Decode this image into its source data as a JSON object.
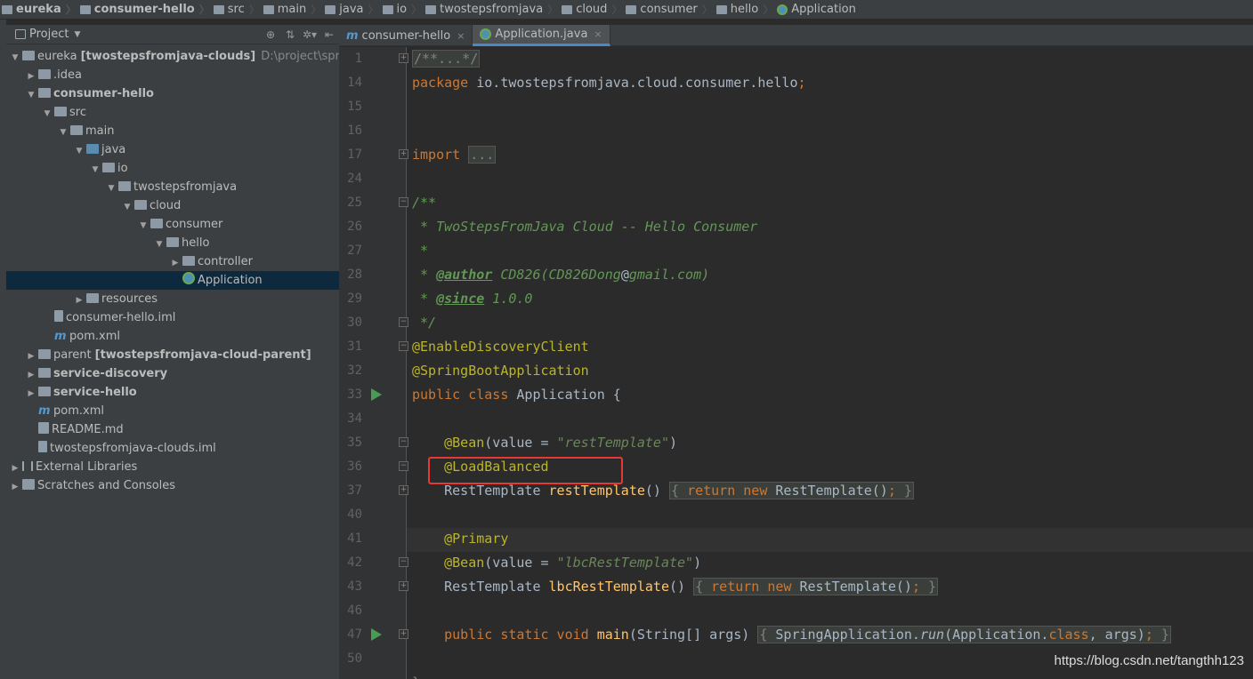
{
  "breadcrumb": [
    "eureka",
    "consumer-hello",
    "src",
    "main",
    "java",
    "io",
    "twostepsfromjava",
    "cloud",
    "consumer",
    "hello",
    "Application"
  ],
  "project_panel": {
    "title": "Project"
  },
  "tree": [
    {
      "depth": 0,
      "arrow": "down",
      "icon": "folder",
      "label": "eureka",
      "bold_extra": "[twostepsfromjava-clouds]",
      "extra": "D:\\project\\springClo"
    },
    {
      "depth": 1,
      "arrow": "right",
      "icon": "folder",
      "label": ".idea"
    },
    {
      "depth": 1,
      "arrow": "down",
      "icon": "folder",
      "label": "consumer-hello",
      "bold": true
    },
    {
      "depth": 2,
      "arrow": "down",
      "icon": "folder",
      "label": "src"
    },
    {
      "depth": 3,
      "arrow": "down",
      "icon": "folder",
      "label": "main"
    },
    {
      "depth": 4,
      "arrow": "down",
      "icon": "src",
      "label": "java"
    },
    {
      "depth": 5,
      "arrow": "down",
      "icon": "folder",
      "label": "io"
    },
    {
      "depth": 6,
      "arrow": "down",
      "icon": "folder",
      "label": "twostepsfromjava"
    },
    {
      "depth": 7,
      "arrow": "down",
      "icon": "folder",
      "label": "cloud"
    },
    {
      "depth": 8,
      "arrow": "down",
      "icon": "folder",
      "label": "consumer"
    },
    {
      "depth": 9,
      "arrow": "down",
      "icon": "folder",
      "label": "hello"
    },
    {
      "depth": 10,
      "arrow": "right",
      "icon": "folder",
      "label": "controller"
    },
    {
      "depth": 10,
      "arrow": "",
      "icon": "app",
      "label": "Application",
      "selected": true
    },
    {
      "depth": 4,
      "arrow": "right",
      "icon": "folder",
      "label": "resources"
    },
    {
      "depth": 2,
      "arrow": "",
      "icon": "iml",
      "label": "consumer-hello.iml"
    },
    {
      "depth": 2,
      "arrow": "",
      "icon": "maven",
      "label": "pom.xml"
    },
    {
      "depth": 1,
      "arrow": "right",
      "icon": "folder",
      "label": "parent",
      "bold_extra": "[twostepsfromjava-cloud-parent]"
    },
    {
      "depth": 1,
      "arrow": "right",
      "icon": "folder",
      "label": "service-discovery",
      "bold": true
    },
    {
      "depth": 1,
      "arrow": "right",
      "icon": "folder",
      "label": "service-hello",
      "bold": true
    },
    {
      "depth": 1,
      "arrow": "",
      "icon": "maven",
      "label": "pom.xml"
    },
    {
      "depth": 1,
      "arrow": "",
      "icon": "md",
      "label": "README.md"
    },
    {
      "depth": 1,
      "arrow": "",
      "icon": "iml",
      "label": "twostepsfromjava-clouds.iml"
    },
    {
      "depth": 0,
      "arrow": "right",
      "icon": "lib",
      "label": "External Libraries"
    },
    {
      "depth": 0,
      "arrow": "right",
      "icon": "scratch",
      "label": "Scratches and Consoles"
    }
  ],
  "tabs": [
    {
      "label": "consumer-hello",
      "icon": "maven",
      "active": false
    },
    {
      "label": "Application.java",
      "icon": "app",
      "active": true
    }
  ],
  "gutter": {
    "line_numbers": [
      "1",
      "14",
      "15",
      "16",
      "17",
      "24",
      "25",
      "26",
      "27",
      "28",
      "29",
      "30",
      "31",
      "32",
      "33",
      "34",
      "35",
      "36",
      "37",
      "40",
      "41",
      "42",
      "43",
      "46",
      "47",
      "50"
    ]
  },
  "code": {
    "l1_fold": "/**...*/",
    "l14_kw": "package",
    "l14_rest": " io.twostepsfromjava.cloud.consumer.hello",
    "l14_semi": ";",
    "l17_kw": "import",
    "l17_fold": "...",
    "l25": "/**",
    "l26": " * TwoStepsFromJava Cloud -- Hello Consumer",
    "l27": " *",
    "l28_star": " * ",
    "l28_tag": "@author",
    "l28_a": " CD826(CD826Dong",
    "l28_at": "@",
    "l28_b": "gmail.com)",
    "l29_star": " * ",
    "l29_tag": "@since",
    "l29_val": " 1.0.0",
    "l30": " */",
    "l31": "@EnableDiscoveryClient",
    "l32": "@SpringBootApplication",
    "l33_kw": "public class",
    "l33_rest": " Application {",
    "l35_an": "    @Bean",
    "l35_a": "(value = ",
    "l35_str": "\"restTemplate\"",
    "l35_b": ")",
    "l36": "    @LoadBalanced",
    "l37_a": "    RestTemplate ",
    "l37_fn": "restTemplate",
    "l37_b": "() ",
    "l37_fold_kw1": "return new",
    "l37_fold_rest": " RestTemplate()",
    "l41": "    @Primary",
    "l42_an": "    @Bean",
    "l42_a": "(value = ",
    "l42_str": "\"lbcRestTemplate\"",
    "l42_b": ")",
    "l43_a": "    RestTemplate ",
    "l43_fn": "lbcRestTemplate",
    "l43_b": "() ",
    "l43_fold_kw1": "return new",
    "l43_fold_rest": " RestTemplate()",
    "l47_kw": "    public static void",
    "l47_fn": " main",
    "l47_a": "(String[] args) ",
    "l47_f1": "SpringApplication.",
    "l47_run": "run",
    "l47_f2": "(Application.",
    "l47_cls": "class",
    "l47_f3": ", args)"
  },
  "watermark": "https://blog.csdn.net/tangthh123",
  "colors": {
    "keyword": "#cc7832",
    "annotation": "#bbb529",
    "string": "#6a8759",
    "doc_comment": "#629755",
    "method": "#ffc66d",
    "highlight_box": "#e53935"
  }
}
